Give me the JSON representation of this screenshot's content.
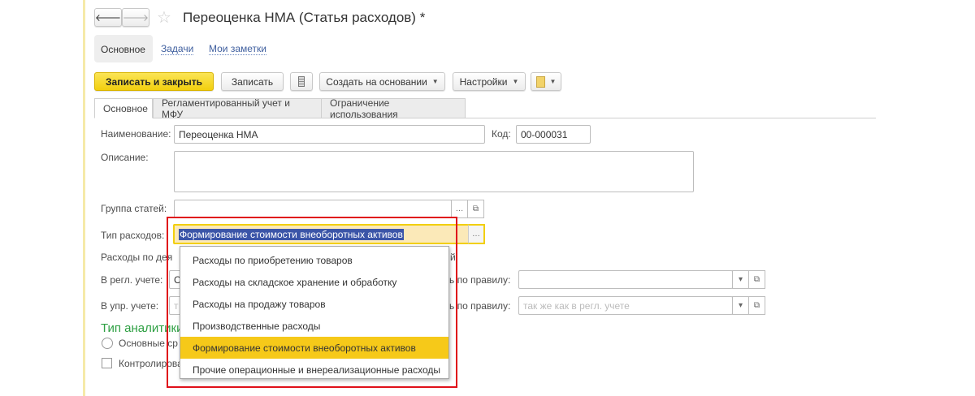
{
  "window": {
    "title": "Переоценка НМА (Статья расходов) *",
    "back_icon": "arrow-left",
    "forward_icon": "arrow-right",
    "favorite_icon": "star"
  },
  "nav": {
    "items": [
      {
        "label": "Основное"
      },
      {
        "label": "Задачи"
      },
      {
        "label": "Мои заметки"
      }
    ]
  },
  "toolbar": {
    "save_close": "Записать и закрыть",
    "save": "Записать",
    "create_based": "Создать на основании",
    "settings": "Настройки",
    "list_icon": "document-list",
    "report_icon": "report-print"
  },
  "tabs": [
    {
      "label": "Основное",
      "active": true
    },
    {
      "label": "Регламентированный учет и МФУ"
    },
    {
      "label": "Ограничение использования"
    }
  ],
  "form": {
    "name_label": "Наименование:",
    "name_value": "Переоценка НМА",
    "code_label": "Код:",
    "code_value": "00-000031",
    "description_label": "Описание:",
    "description_value": "",
    "group_label": "Группа статей:",
    "group_value": "",
    "expense_type_label": "Тип расходов:",
    "expense_type_value": "Формирование стоимости внеоборотных активов",
    "activity_label": "Расходы по дея",
    "activity_tail": "й",
    "regl_label": "В регл. учете:",
    "regl_value_partial": "С",
    "upr_label": "В упр. учете:",
    "upr_placeholder_partial": "т",
    "rule_label": "ь по правилу:",
    "rule_regl_value": "",
    "rule_upr_placeholder": "так же как в регл. учете",
    "analytics_label": "Тип аналитики",
    "radio_label": "Основные ср",
    "checkbox_label": "Контролирова"
  },
  "dropdown": {
    "selected_index": 4,
    "items": [
      "Расходы по приобретению товаров",
      "Расходы на складское хранение и обработку",
      "Расходы на продажу товаров",
      "Производственные расходы",
      "Формирование стоимости внеоборотных активов",
      "Прочие операционные и внереализационные расходы"
    ]
  },
  "colors": {
    "accent_yellow": "#f2cf0e",
    "highlight": "#f6c919",
    "annotation_red": "#e0101a",
    "analytics_green": "#2ea043",
    "selection_blue": "#3b55a8"
  }
}
